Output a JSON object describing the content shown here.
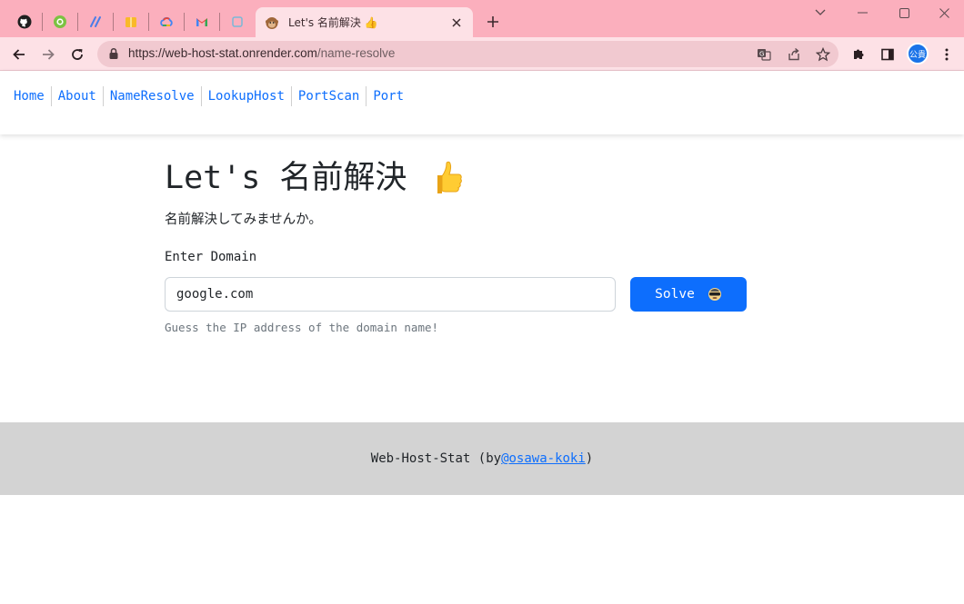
{
  "browser": {
    "pinned_tabs": [
      {
        "icon": "github-icon"
      },
      {
        "icon": "green-circle-app-icon"
      },
      {
        "icon": "blue-slash-app-icon"
      },
      {
        "icon": "yellow-box-app-icon"
      },
      {
        "icon": "google-cloud-icon"
      },
      {
        "icon": "gmail-icon"
      },
      {
        "icon": "square-app-icon"
      }
    ],
    "active_tab": {
      "title": "Let's 名前解決 👍",
      "icon": "monkey-favicon-icon"
    },
    "url_host": "https://web-host-stat.onrender.com",
    "url_path": "/name-resolve",
    "profile_avatar_text": "公貴",
    "colors": {
      "tabstrip": "#fbafbd",
      "toolbar": "#fde1e6",
      "omnibox": "#f1c9d0"
    }
  },
  "nav": {
    "items": [
      {
        "label": "Home"
      },
      {
        "label": "About"
      },
      {
        "label": "NameResolve"
      },
      {
        "label": "LookupHost"
      },
      {
        "label": "PortScan"
      },
      {
        "label": "Port"
      }
    ]
  },
  "main": {
    "title": "Let's 名前解決",
    "title_emoji": "thumbs-up-icon",
    "subtitle": "名前解決してみませんか。",
    "field_label": "Enter Domain",
    "input_value": "google.com",
    "solve_label": "Solve",
    "solve_icon": "disguised-face-icon",
    "help_text": "Guess the IP address of the domain name!"
  },
  "footer": {
    "prefix": "Web-Host-Stat (by",
    "link_text": "@osawa-koki",
    "suffix": ")"
  },
  "colors": {
    "primary": "#0d6efd",
    "footer_bg": "#d3d3d3",
    "text": "#212529",
    "muted": "#6c757d"
  }
}
